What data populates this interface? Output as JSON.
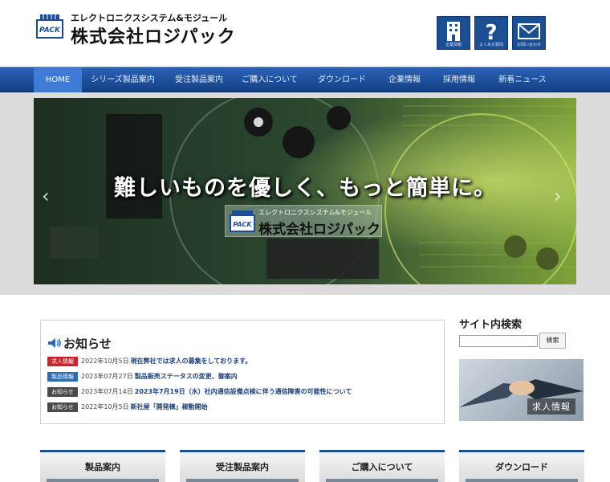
{
  "header": {
    "tagline": "エレクトロニクスシステム&モジュール",
    "company_name": "株式会社ロジパック",
    "logo_text": "PACK",
    "icons": [
      {
        "name": "company-info-icon",
        "label": "企業情報"
      },
      {
        "name": "faq-icon",
        "label": "よくある質問"
      },
      {
        "name": "contact-icon",
        "label": "お問い合わせ"
      }
    ]
  },
  "nav": {
    "items": [
      "HOME",
      "シリーズ製品案内",
      "受注製品案内",
      "ご購入について",
      "ダウンロード",
      "企業情報",
      "採用情報",
      "新着ニュース"
    ]
  },
  "hero": {
    "headline": "難しいものを優しく、もっと簡単に。",
    "logo_tagline": "エレクトロニクスシステム&モジュール",
    "logo_name": "株式会社ロジパック",
    "prev_arrow": "‹",
    "next_arrow": "›"
  },
  "news": {
    "title": "お知らせ",
    "items": [
      {
        "badge": "求人情報",
        "badge_color": "#c8242b",
        "date": "2022年10月5日",
        "text": "現在弊社では求人の募集をしております。"
      },
      {
        "badge": "製品情報",
        "badge_color": "#2e6bb0",
        "date": "2023年07月27日",
        "text": "製品販売ステータスの変更、御案内"
      },
      {
        "badge": "お知らせ",
        "badge_color": "#4a4a4a",
        "date": "2023年07月14日",
        "text": "2023年7月19日（水）社内通信設備点検に伴う通信障害の可能性について"
      },
      {
        "badge": "お知らせ",
        "badge_color": "#4a4a4a",
        "date": "2022年10月5日",
        "text": "新社屋「開発棟」稼動開始"
      }
    ]
  },
  "search": {
    "title": "サイト内検索",
    "button_label": "検索",
    "placeholder": ""
  },
  "recruit": {
    "label": "求人情報"
  },
  "cards": [
    {
      "title": "製品案内"
    },
    {
      "title": "受注製品案内"
    },
    {
      "title": "ご購入について"
    },
    {
      "title": "ダウンロード"
    }
  ],
  "colors": {
    "brand": "#1b4e92",
    "nav_active": "#3f7ad4"
  }
}
